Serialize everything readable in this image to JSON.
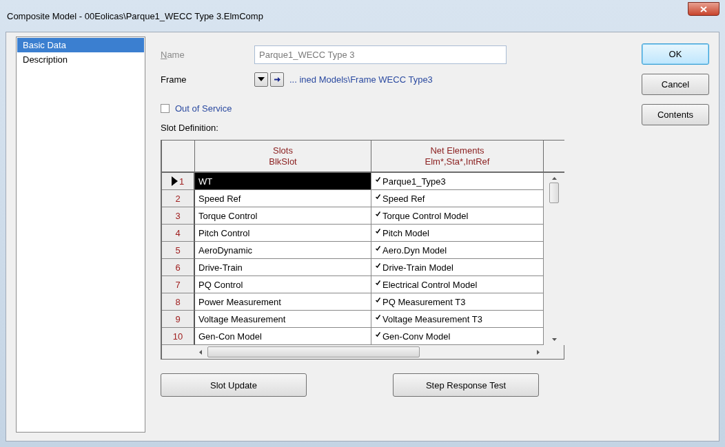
{
  "window": {
    "title": "Composite Model - 00Eolicas\\Parque1_WECC Type 3.ElmComp"
  },
  "sidebar": {
    "items": [
      {
        "label": "Basic Data",
        "selected": true
      },
      {
        "label": "Description",
        "selected": false
      }
    ]
  },
  "name": {
    "label": "Name",
    "value": "Parque1_WECC Type 3",
    "disabled": true
  },
  "frame": {
    "label": "Frame",
    "path": "... ined Models\\Frame WECC Type3"
  },
  "out_of_service": {
    "label": "Out of Service",
    "checked": false
  },
  "slot_definition": {
    "label": "Slot Definition:",
    "columns": [
      {
        "title": "Slots",
        "subtitle": "BlkSlot"
      },
      {
        "title": "Net Elements",
        "subtitle": "Elm*,Sta*,IntRef"
      }
    ],
    "rows": [
      {
        "number": "1",
        "slot": "WT",
        "element": "Parque1_Type3",
        "selected": true
      },
      {
        "number": "2",
        "slot": "Speed Ref",
        "element": "Speed Ref",
        "selected": false
      },
      {
        "number": "3",
        "slot": "Torque Control",
        "element": "Torque Control Model",
        "selected": false
      },
      {
        "number": "4",
        "slot": "Pitch Control",
        "element": "Pitch Model",
        "selected": false
      },
      {
        "number": "5",
        "slot": "AeroDynamic",
        "element": "Aero.Dyn Model",
        "selected": false
      },
      {
        "number": "6",
        "slot": "Drive-Train",
        "element": "Drive-Train Model",
        "selected": false
      },
      {
        "number": "7",
        "slot": "PQ Control",
        "element": "Electrical Control Model",
        "selected": false
      },
      {
        "number": "8",
        "slot": "Power Measurement",
        "element": "PQ Measurement T3",
        "selected": false
      },
      {
        "number": "9",
        "slot": "Voltage Measurement",
        "element": "Voltage Measurement T3",
        "selected": false
      },
      {
        "number": "10",
        "slot": "Gen-Con Model",
        "element": "Gen-Conv Model",
        "selected": false
      }
    ]
  },
  "table_buttons": [
    "Slot Update",
    "Step Response Test"
  ],
  "buttons": [
    {
      "label": "OK",
      "default": true
    },
    {
      "label": "Cancel",
      "default": false
    },
    {
      "label": "Contents",
      "default": false
    }
  ]
}
